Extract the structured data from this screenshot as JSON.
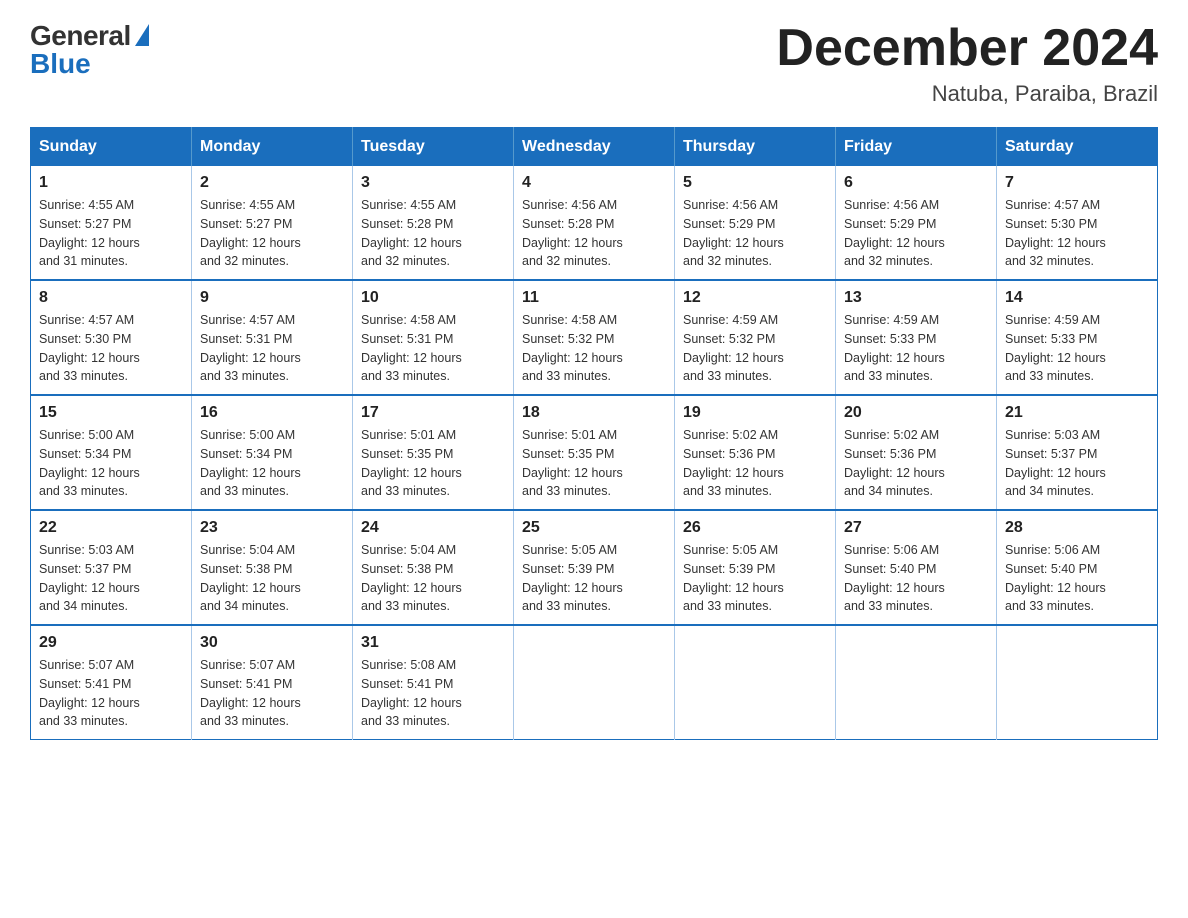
{
  "logo": {
    "general": "General",
    "blue": "Blue"
  },
  "title": "December 2024",
  "subtitle": "Natuba, Paraiba, Brazil",
  "days_of_week": [
    "Sunday",
    "Monday",
    "Tuesday",
    "Wednesday",
    "Thursday",
    "Friday",
    "Saturday"
  ],
  "weeks": [
    [
      {
        "day": "1",
        "sunrise": "4:55 AM",
        "sunset": "5:27 PM",
        "daylight": "12 hours and 31 minutes."
      },
      {
        "day": "2",
        "sunrise": "4:55 AM",
        "sunset": "5:27 PM",
        "daylight": "12 hours and 32 minutes."
      },
      {
        "day": "3",
        "sunrise": "4:55 AM",
        "sunset": "5:28 PM",
        "daylight": "12 hours and 32 minutes."
      },
      {
        "day": "4",
        "sunrise": "4:56 AM",
        "sunset": "5:28 PM",
        "daylight": "12 hours and 32 minutes."
      },
      {
        "day": "5",
        "sunrise": "4:56 AM",
        "sunset": "5:29 PM",
        "daylight": "12 hours and 32 minutes."
      },
      {
        "day": "6",
        "sunrise": "4:56 AM",
        "sunset": "5:29 PM",
        "daylight": "12 hours and 32 minutes."
      },
      {
        "day": "7",
        "sunrise": "4:57 AM",
        "sunset": "5:30 PM",
        "daylight": "12 hours and 32 minutes."
      }
    ],
    [
      {
        "day": "8",
        "sunrise": "4:57 AM",
        "sunset": "5:30 PM",
        "daylight": "12 hours and 33 minutes."
      },
      {
        "day": "9",
        "sunrise": "4:57 AM",
        "sunset": "5:31 PM",
        "daylight": "12 hours and 33 minutes."
      },
      {
        "day": "10",
        "sunrise": "4:58 AM",
        "sunset": "5:31 PM",
        "daylight": "12 hours and 33 minutes."
      },
      {
        "day": "11",
        "sunrise": "4:58 AM",
        "sunset": "5:32 PM",
        "daylight": "12 hours and 33 minutes."
      },
      {
        "day": "12",
        "sunrise": "4:59 AM",
        "sunset": "5:32 PM",
        "daylight": "12 hours and 33 minutes."
      },
      {
        "day": "13",
        "sunrise": "4:59 AM",
        "sunset": "5:33 PM",
        "daylight": "12 hours and 33 minutes."
      },
      {
        "day": "14",
        "sunrise": "4:59 AM",
        "sunset": "5:33 PM",
        "daylight": "12 hours and 33 minutes."
      }
    ],
    [
      {
        "day": "15",
        "sunrise": "5:00 AM",
        "sunset": "5:34 PM",
        "daylight": "12 hours and 33 minutes."
      },
      {
        "day": "16",
        "sunrise": "5:00 AM",
        "sunset": "5:34 PM",
        "daylight": "12 hours and 33 minutes."
      },
      {
        "day": "17",
        "sunrise": "5:01 AM",
        "sunset": "5:35 PM",
        "daylight": "12 hours and 33 minutes."
      },
      {
        "day": "18",
        "sunrise": "5:01 AM",
        "sunset": "5:35 PM",
        "daylight": "12 hours and 33 minutes."
      },
      {
        "day": "19",
        "sunrise": "5:02 AM",
        "sunset": "5:36 PM",
        "daylight": "12 hours and 33 minutes."
      },
      {
        "day": "20",
        "sunrise": "5:02 AM",
        "sunset": "5:36 PM",
        "daylight": "12 hours and 34 minutes."
      },
      {
        "day": "21",
        "sunrise": "5:03 AM",
        "sunset": "5:37 PM",
        "daylight": "12 hours and 34 minutes."
      }
    ],
    [
      {
        "day": "22",
        "sunrise": "5:03 AM",
        "sunset": "5:37 PM",
        "daylight": "12 hours and 34 minutes."
      },
      {
        "day": "23",
        "sunrise": "5:04 AM",
        "sunset": "5:38 PM",
        "daylight": "12 hours and 34 minutes."
      },
      {
        "day": "24",
        "sunrise": "5:04 AM",
        "sunset": "5:38 PM",
        "daylight": "12 hours and 33 minutes."
      },
      {
        "day": "25",
        "sunrise": "5:05 AM",
        "sunset": "5:39 PM",
        "daylight": "12 hours and 33 minutes."
      },
      {
        "day": "26",
        "sunrise": "5:05 AM",
        "sunset": "5:39 PM",
        "daylight": "12 hours and 33 minutes."
      },
      {
        "day": "27",
        "sunrise": "5:06 AM",
        "sunset": "5:40 PM",
        "daylight": "12 hours and 33 minutes."
      },
      {
        "day": "28",
        "sunrise": "5:06 AM",
        "sunset": "5:40 PM",
        "daylight": "12 hours and 33 minutes."
      }
    ],
    [
      {
        "day": "29",
        "sunrise": "5:07 AM",
        "sunset": "5:41 PM",
        "daylight": "12 hours and 33 minutes."
      },
      {
        "day": "30",
        "sunrise": "5:07 AM",
        "sunset": "5:41 PM",
        "daylight": "12 hours and 33 minutes."
      },
      {
        "day": "31",
        "sunrise": "5:08 AM",
        "sunset": "5:41 PM",
        "daylight": "12 hours and 33 minutes."
      },
      null,
      null,
      null,
      null
    ]
  ],
  "labels": {
    "sunrise": "Sunrise:",
    "sunset": "Sunset:",
    "daylight": "Daylight:"
  }
}
